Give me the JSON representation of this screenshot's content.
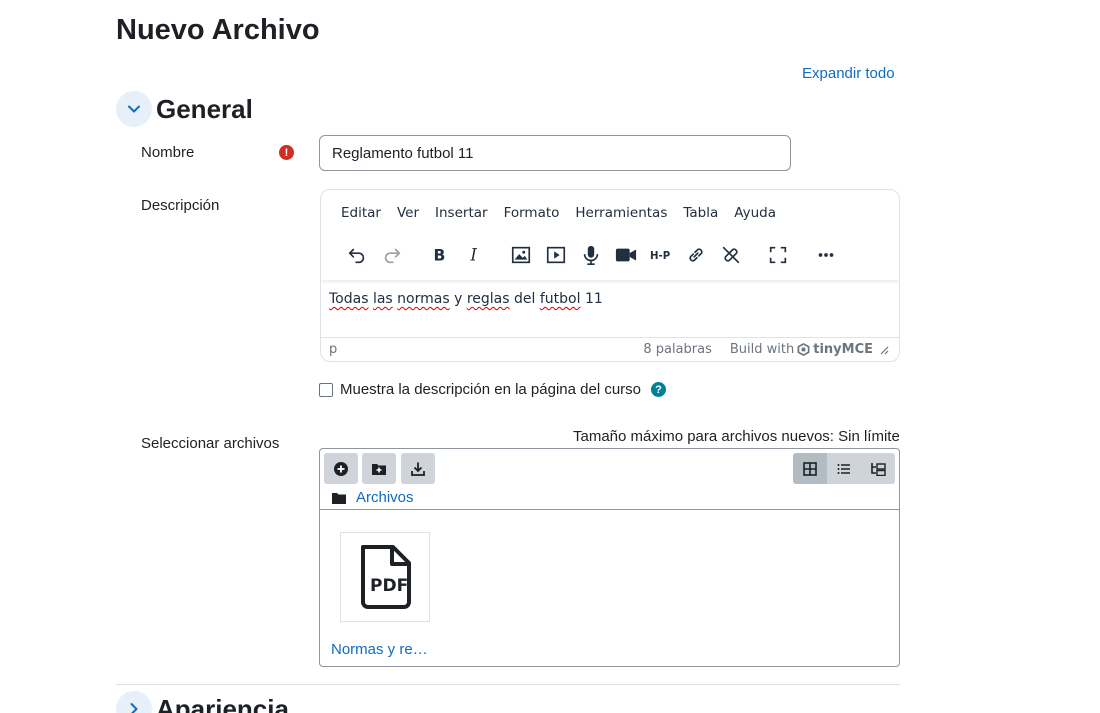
{
  "page": {
    "title": "Nuevo Archivo",
    "expand_all": "Expandir todo"
  },
  "sections": {
    "general": "General",
    "appearance": "Apariencia"
  },
  "fields": {
    "name_label": "Nombre",
    "name_value": "Reglamento futbol 11",
    "required_symbol": "!",
    "description_label": "Descripción",
    "show_desc_label": "Muestra la descripción en la página del curso",
    "help_symbol": "?",
    "select_files_label": "Seleccionar archivos"
  },
  "editor": {
    "menu": [
      "Editar",
      "Ver",
      "Insertar",
      "Formato",
      "Herramientas",
      "Tabla",
      "Ayuda"
    ],
    "content": {
      "w1": "Todas",
      "w2": "las",
      "w3": "normas",
      "w4": "y",
      "w5": "reglas",
      "w6": "del",
      "w7": "futbol",
      "w8": "11"
    },
    "status_path": "p",
    "word_count": "8 palabras",
    "build_with": "Build with",
    "brand": "tinyMCE"
  },
  "filepicker": {
    "max_size": "Tamaño máximo para archivos nuevos: Sin límite",
    "folder": "Archivos",
    "files": [
      {
        "name": "Normas y re…",
        "type": "PDF"
      }
    ]
  }
}
